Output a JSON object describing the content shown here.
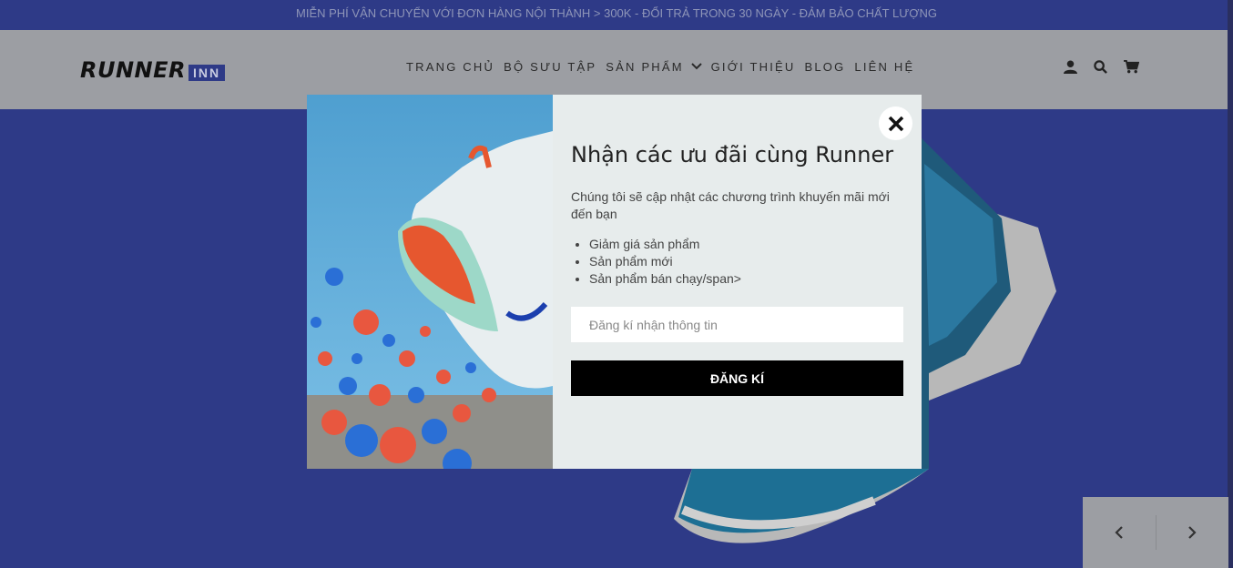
{
  "topbar": {
    "text": "MIỄN PHÍ VẬN CHUYỂN VỚI ĐƠN HÀNG NỘI THÀNH > 300K - ĐỔI TRẢ TRONG 30 NGÀY - ĐẢM BẢO CHẤT LƯỢNG"
  },
  "header": {
    "logo": {
      "word": "RUNNER",
      "badge": "INN"
    },
    "nav": [
      {
        "label": "TRANG CHỦ"
      },
      {
        "label": "BỘ SƯU TẬP"
      },
      {
        "label": "SẢN PHẨM"
      },
      {
        "label": "GIỚI THIỆU"
      },
      {
        "label": "BLOG"
      },
      {
        "label": "LIÊN HỆ"
      }
    ],
    "icons": [
      "user-icon",
      "search-icon",
      "cart-icon"
    ]
  },
  "popup": {
    "title": "Nhận các ưu đãi cùng Runner",
    "description": "Chúng tôi sẽ cập nhật các chương trình khuyến mãi mới đến bạn",
    "benefits": [
      "Giảm giá sản phẩm",
      "Sản phẩm mới",
      "Sản phẩm bán chạy/span>"
    ],
    "email_placeholder": "Đăng kí nhận thông tin",
    "submit_label": "ĐĂNG KÍ",
    "close_icon": "close-icon"
  },
  "slider": {
    "prev_icon": "chevron-left-icon",
    "next_icon": "chevron-right-icon"
  },
  "colors": {
    "brand_blue": "#2e3a87",
    "header_gray": "#9c9ea3",
    "button_black": "#000000"
  }
}
